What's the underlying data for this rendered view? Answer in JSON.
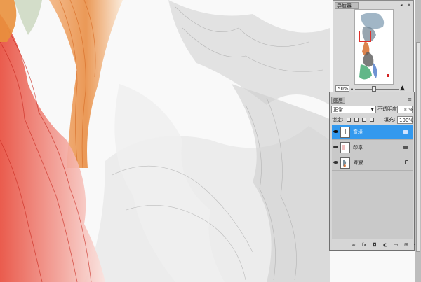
{
  "navigator": {
    "title": "导航器",
    "zoom": "50%"
  },
  "layers": {
    "tab": "图层",
    "blend_mode": "正常",
    "opacity_label": "不透明度:",
    "opacity_value": "100%",
    "lock_label": "锁定:",
    "fill_label": "填充:",
    "fill_value": "100%",
    "items": [
      {
        "name": "意境",
        "thumb": "T",
        "selected": true
      },
      {
        "name": "印章",
        "thumb": "",
        "selected": false
      },
      {
        "name": "背景",
        "thumb": "",
        "selected": false
      }
    ],
    "footer_icons": [
      "link-icon",
      "fx-icon",
      "mask-icon",
      "adjustment-icon",
      "group-icon",
      "new-layer-icon",
      "trash-icon"
    ]
  },
  "colors": {
    "selection": "#3399ee",
    "panel": "#d6d6d6",
    "nav_view_box": "#e0302a"
  }
}
